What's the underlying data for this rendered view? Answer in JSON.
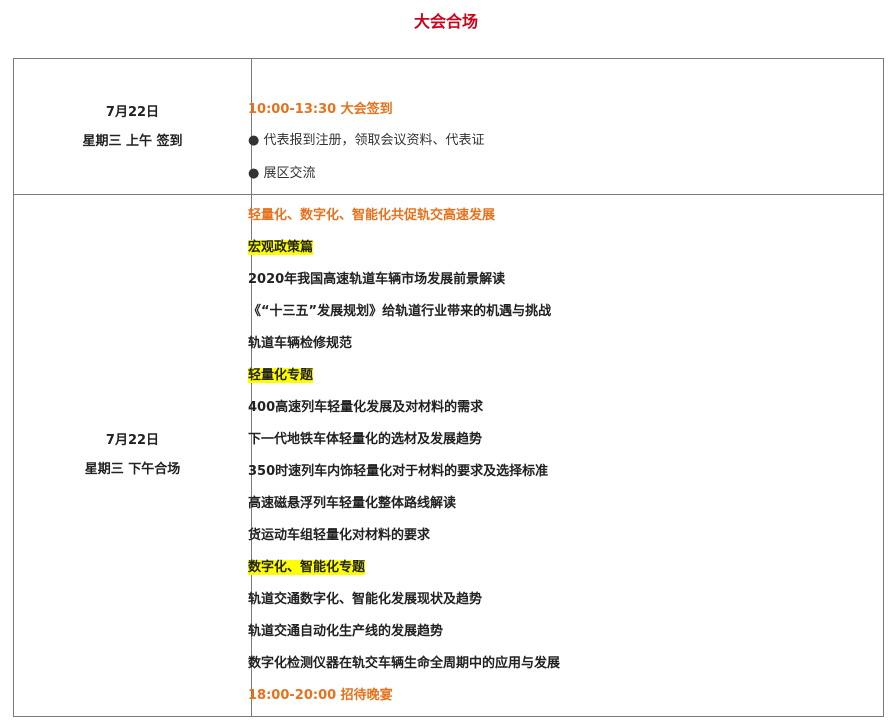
{
  "title": "大会合场",
  "morning": {
    "date": "7月22日",
    "day": "星期三  上午  签到",
    "items": [
      {
        "text": "10:00-13:30 大会签到",
        "style": "orange"
      },
      {
        "text": "● 代表报到注册，领取会议资料、代表证",
        "style": "plain"
      },
      {
        "text": "● 展区交流",
        "style": "plain"
      }
    ]
  },
  "afternoon": {
    "date": "7月22日",
    "day": "星期三  下午合场",
    "items": [
      {
        "text": " 轻量化、数字化、智能化共促轨交高速发展",
        "style": "orange"
      },
      {
        "text": "宏观政策篇",
        "style": "hl"
      },
      {
        "text": "2020年我国高速轨道车辆市场发展前景解读",
        "style": "bold"
      },
      {
        "text": "《“十三五”发展规划》给轨道行业带来的机遇与挑战",
        "style": "bold"
      },
      {
        "text": "轨道车辆检修规范",
        "style": "bold"
      },
      {
        "text": "轻量化专题",
        "style": "hl"
      },
      {
        "text": "400高速列车轻量化发展及对材料的需求",
        "style": "bold"
      },
      {
        "text": "下一代地铁车体轻量化的选材及发展趋势",
        "style": "bold"
      },
      {
        "text": "350时速列车内饰轻量化对于材料的要求及选择标准",
        "style": "bold"
      },
      {
        "text": "高速磁悬浮列车轻量化整体路线解读",
        "style": "bold"
      },
      {
        "text": "货运动车组轻量化对材料的要求",
        "style": "bold"
      },
      {
        "text": "数字化、智能化专题",
        "style": "hl"
      },
      {
        "text": "轨道交通数字化、智能化发展现状及趋势",
        "style": "bold"
      },
      {
        "text": "轨道交通自动化生产线的发展趋势",
        "style": "bold"
      },
      {
        "text": "数字化检测仪器在轨交车辆生命全周期中的应用与发展",
        "style": "bold"
      },
      {
        "text": "18:00-20:00  招待晚宴",
        "style": "orange"
      }
    ]
  }
}
